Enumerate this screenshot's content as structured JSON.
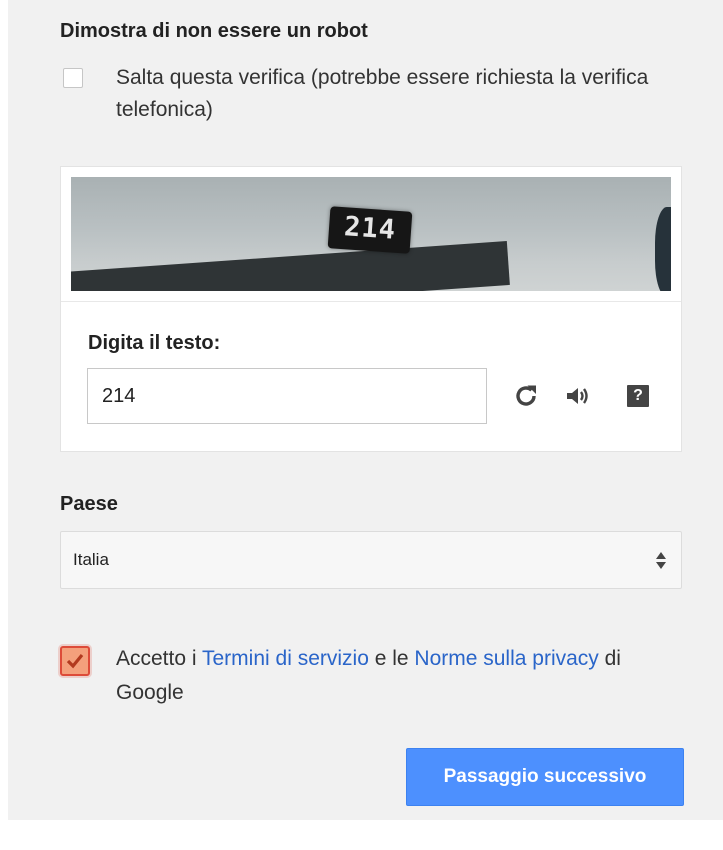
{
  "form": {
    "section_title": "Dimostra di non essere un robot",
    "skip": {
      "label": "Salta questa verifica (potrebbe essere richiesta la verifica telefonica)",
      "checked": false
    }
  },
  "captcha": {
    "image_text": "214",
    "type_label": "Digita il testo:",
    "input_value": "214",
    "icons": {
      "refresh": "refresh-icon",
      "audio": "audio-icon",
      "help": "help-icon"
    },
    "help_glyph": "?"
  },
  "country": {
    "label": "Paese",
    "selected": "Italia"
  },
  "terms": {
    "checked": true,
    "prefix": "Accetto i ",
    "terms_link": "Termini di servizio",
    "middle": " e le ",
    "privacy_link": "Norme sulla privacy",
    "suffix": " di Google"
  },
  "actions": {
    "next_label": "Passaggio successivo"
  },
  "colors": {
    "primary_button": "#4d90fe",
    "link": "#2a65c9",
    "checked_accent": "#dd4b39",
    "panel_bg": "#f1f1f1"
  }
}
